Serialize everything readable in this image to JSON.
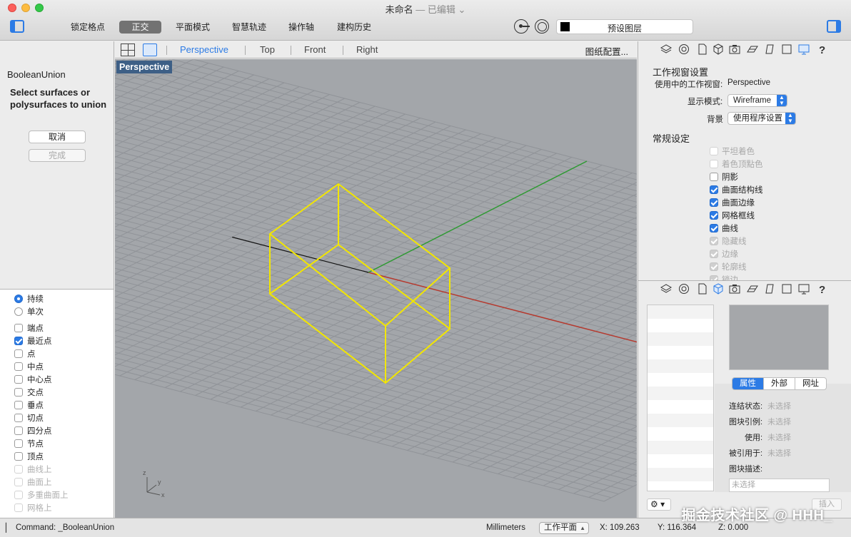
{
  "window": {
    "title": "未命名",
    "edited": "— 已编辑",
    "chevron": "⌄"
  },
  "toolbar": {
    "lock_grid": "锁定格点",
    "ortho": "正交",
    "planar": "平面模式",
    "smarttrack": "智慧轨迹",
    "gumball": "操作轴",
    "history": "建构历史",
    "layer_name": "预设图层"
  },
  "command_panel": {
    "command": "BooleanUnion",
    "prompt": "Select surfaces or polysurfaces to union",
    "cancel": "取消",
    "done": "完成"
  },
  "osnap": {
    "mode_items": [
      {
        "label": "持续",
        "checked": true
      },
      {
        "label": "单次",
        "checked": false
      }
    ],
    "items": [
      {
        "label": "端点",
        "checked": false,
        "dim": false
      },
      {
        "label": "最近点",
        "checked": true,
        "dim": false
      },
      {
        "label": "点",
        "checked": false,
        "dim": false
      },
      {
        "label": "中点",
        "checked": false,
        "dim": false
      },
      {
        "label": "中心点",
        "checked": false,
        "dim": false
      },
      {
        "label": "交点",
        "checked": false,
        "dim": false
      },
      {
        "label": "垂点",
        "checked": false,
        "dim": false
      },
      {
        "label": "切点",
        "checked": false,
        "dim": false
      },
      {
        "label": "四分点",
        "checked": false,
        "dim": false
      },
      {
        "label": "节点",
        "checked": false,
        "dim": false
      },
      {
        "label": "顶点",
        "checked": false,
        "dim": false
      },
      {
        "label": "曲线上",
        "checked": false,
        "dim": true
      },
      {
        "label": "曲面上",
        "checked": false,
        "dim": true
      },
      {
        "label": "多重曲面上",
        "checked": false,
        "dim": true
      },
      {
        "label": "网格上",
        "checked": false,
        "dim": true
      }
    ]
  },
  "viewport_tabs": {
    "perspective": "Perspective",
    "top": "Top",
    "front": "Front",
    "right": "Right",
    "config": "图纸配置..."
  },
  "viewport": {
    "label": "Perspective",
    "axis_z": "z",
    "axis_y": "y",
    "axis_x": "x"
  },
  "view_settings": {
    "title": "工作视窗设置",
    "active_label": "使用中的工作视窗:",
    "active_value": "Perspective",
    "display_mode_label": "显示模式:",
    "display_mode_value": "Wireframe",
    "background_label": "背景",
    "background_value": "使用程序设置",
    "general_title": "常规设定",
    "options": [
      {
        "label": "平坦着色",
        "checked": false,
        "dim": true
      },
      {
        "label": "着色顶點色",
        "checked": false,
        "dim": true
      },
      {
        "label": "阴影",
        "checked": false,
        "dim": false
      },
      {
        "label": "曲面结构线",
        "checked": true,
        "dim": false
      },
      {
        "label": "曲面边缘",
        "checked": true,
        "dim": false
      },
      {
        "label": "网格框线",
        "checked": true,
        "dim": false
      },
      {
        "label": "曲线",
        "checked": true,
        "dim": false
      },
      {
        "label": "隐藏线",
        "checked": true,
        "dim": true
      },
      {
        "label": "边缘",
        "checked": true,
        "dim": true
      },
      {
        "label": "轮廓线",
        "checked": true,
        "dim": true
      },
      {
        "label": "锁边",
        "checked": true,
        "dim": true
      }
    ]
  },
  "block_panel": {
    "tabs": [
      "属性",
      "外部",
      "网址"
    ],
    "link_status_label": "连结状态:",
    "block_instance_label": "图块引例:",
    "usage_label": "使用:",
    "referenced_by_label": "被引用于:",
    "description_label": "图块描述:",
    "unselected": "未选择",
    "gear": "⚙ ▾",
    "insert": "插入"
  },
  "statusbar": {
    "command": "Command: _BooleanUnion",
    "units": "Millimeters",
    "cplane": "工作平面",
    "x": "X: 109.263",
    "y": "Y: 116.364",
    "z": "Z: 0.000"
  },
  "watermark": "掘金技术社区 @ HHH_",
  "colors": {
    "accent": "#2c7be5",
    "viewport_bg": "#a3a6aa",
    "grid": "#8f9296",
    "selection": "#f2e600",
    "x_axis": "#b53a2f",
    "y_axis": "#2e9a32"
  }
}
